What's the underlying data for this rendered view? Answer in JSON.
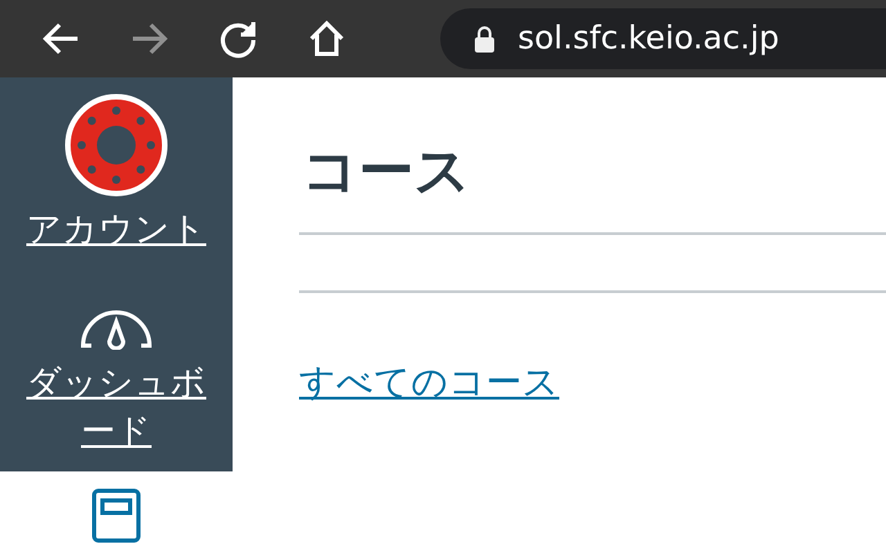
{
  "browser": {
    "address": "sol.sfc.keio.ac.jp",
    "back_disabled": false,
    "forward_disabled": true
  },
  "sidebar": {
    "items": [
      {
        "kind": "account",
        "label": "アカウント",
        "selected": false
      },
      {
        "kind": "dashboard",
        "label": "ダッシュボード",
        "selected": false
      },
      {
        "kind": "courses",
        "selected": true
      }
    ]
  },
  "main": {
    "heading": "コース",
    "link": "すべてのコース"
  }
}
